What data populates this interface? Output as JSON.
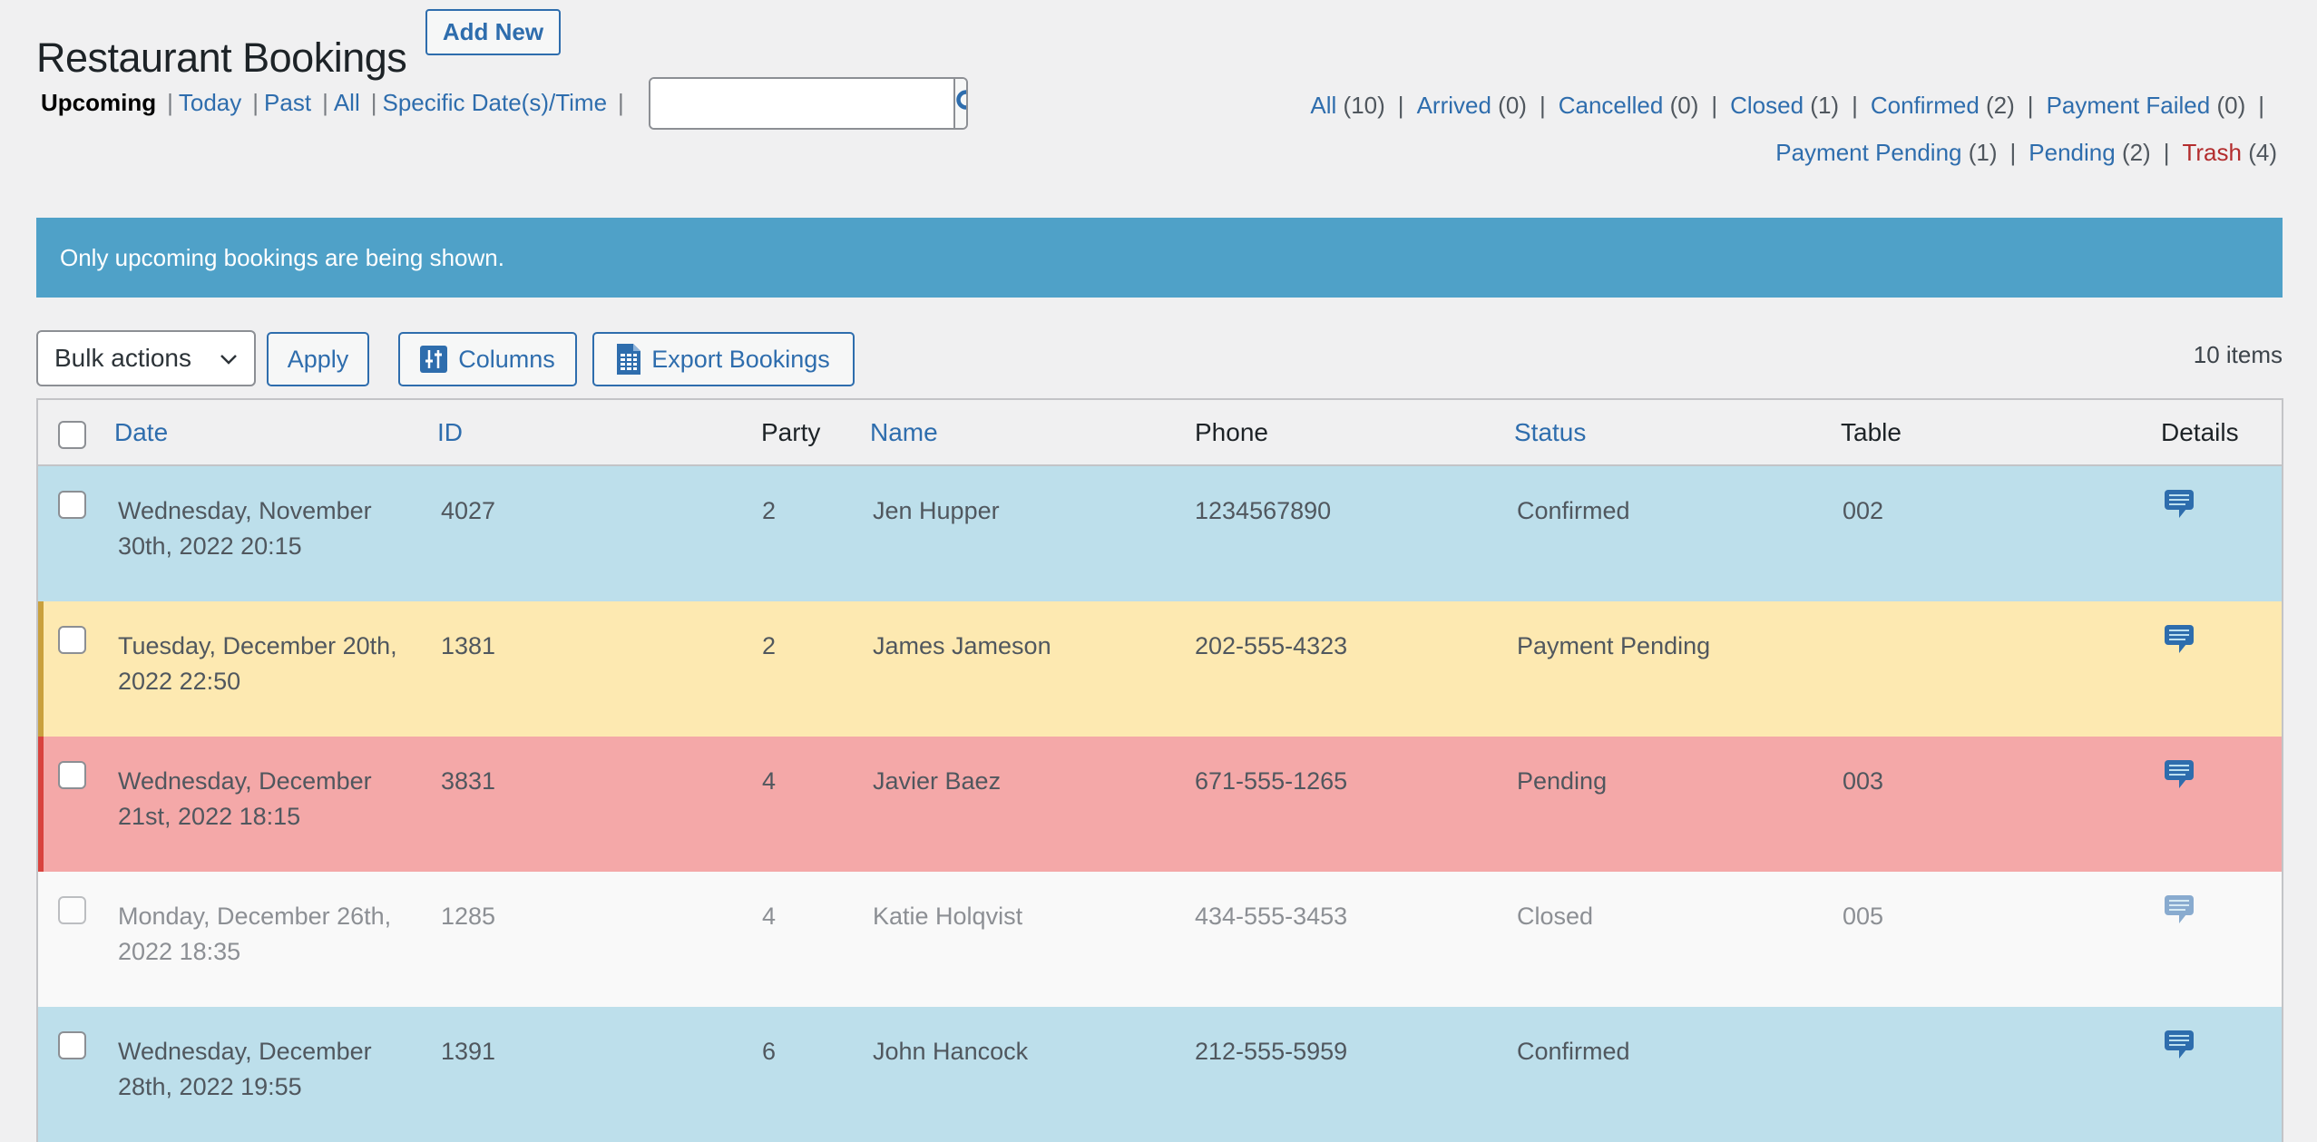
{
  "header": {
    "title": "Restaurant Bookings",
    "add_new_label": "Add New"
  },
  "views": [
    {
      "label": "Upcoming",
      "current": true
    },
    {
      "label": "Today"
    },
    {
      "label": "Past"
    },
    {
      "label": "All"
    },
    {
      "label": "Specific Date(s)/Time"
    }
  ],
  "search": {
    "value": "",
    "placeholder": "",
    "icon": "search-icon"
  },
  "status_filters": [
    {
      "label": "All",
      "count": "(10)"
    },
    {
      "label": "Arrived",
      "count": "(0)"
    },
    {
      "label": "Cancelled",
      "count": "(0)"
    },
    {
      "label": "Closed",
      "count": "(1)"
    },
    {
      "label": "Confirmed",
      "count": "(2)"
    },
    {
      "label": "Payment Failed",
      "count": "(0)"
    },
    {
      "label": "Payment Pending",
      "count": "(1)"
    },
    {
      "label": "Pending",
      "count": "(2)"
    },
    {
      "label": "Trash",
      "count": "(4)"
    }
  ],
  "notice": "Only upcoming bookings are being shown.",
  "toolbar": {
    "bulk_actions_label": "Bulk actions",
    "apply_label": "Apply",
    "columns_label": "Columns",
    "export_label": "Export Bookings",
    "items_count": "10 items"
  },
  "table": {
    "columns": {
      "date": "Date",
      "id": "ID",
      "party": "Party",
      "name": "Name",
      "phone": "Phone",
      "status": "Status",
      "table": "Table",
      "details": "Details"
    },
    "rows": [
      {
        "date": "Wednesday, November 30th, 2022 20:15",
        "id": "4027",
        "party": "2",
        "name": "Jen Hupper",
        "phone": "1234567890",
        "status": "Confirmed",
        "table": "002",
        "row_class": "confirmed"
      },
      {
        "date": "Tuesday, December 20th, 2022 22:50",
        "id": "1381",
        "party": "2",
        "name": "James Jameson",
        "phone": "202-555-4323",
        "status": "Payment Pending",
        "table": "",
        "row_class": "payment-pending"
      },
      {
        "date": "Wednesday, December 21st, 2022 18:15",
        "id": "3831",
        "party": "4",
        "name": "Javier Baez",
        "phone": "671-555-1265",
        "status": "Pending",
        "table": "003",
        "row_class": "pending"
      },
      {
        "date": "Monday, December 26th, 2022 18:35",
        "id": "1285",
        "party": "4",
        "name": "Katie Holqvist",
        "phone": "434-555-3453",
        "status": "Closed",
        "table": "005",
        "row_class": "closed"
      },
      {
        "date": "Wednesday, December 28th, 2022 19:55",
        "id": "1391",
        "party": "6",
        "name": "John Hancock",
        "phone": "212-555-5959",
        "status": "Confirmed",
        "table": "",
        "row_class": "confirmed"
      }
    ]
  },
  "colors": {
    "link": "#2e6dad",
    "notice_bg": "#4fa1c8",
    "confirmed_bg": "#bddfeb",
    "payment_pending_bg": "#fde9b1",
    "pending_bg": "#f4a8a8",
    "closed_bg": "#f9f9f9",
    "trash": "#b32d2e"
  }
}
